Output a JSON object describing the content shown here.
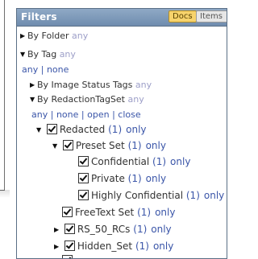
{
  "panel": {
    "title": "Filters",
    "buttons": {
      "docs": "Docs",
      "items": "Items"
    }
  },
  "folder": {
    "label": "By Folder",
    "value": "any"
  },
  "tag": {
    "label": "By Tag",
    "value": "any",
    "choices": {
      "any": "any",
      "sep": "|",
      "none": "none"
    }
  },
  "image_status": {
    "label": "By Image Status Tags",
    "value": "any"
  },
  "redaction": {
    "label": "By RedactionTagSet",
    "value": "any",
    "choices": {
      "any": "any",
      "sep1": "|",
      "none": "none",
      "sep2": "|",
      "open": "open",
      "sep3": "|",
      "close": "close"
    }
  },
  "tree": {
    "redacted": {
      "label": "Redacted",
      "count": "(1)",
      "only": "only"
    },
    "preset": {
      "label": "Preset Set",
      "count": "(1)",
      "only": "only"
    },
    "confidential": {
      "label": "Confidential",
      "count": "(1)",
      "only": "only"
    },
    "private": {
      "label": "Private",
      "count": "(1)",
      "only": "only"
    },
    "highly_confidential": {
      "label": "Highly Confidential",
      "count": "(1)",
      "only": "only"
    },
    "freetext": {
      "label": "FreeText Set",
      "count": "(1)",
      "only": "only"
    },
    "rs50": {
      "label": "RS_50_RCs",
      "count": "(1)",
      "only": "only"
    },
    "hidden": {
      "label": "Hidden_Set",
      "count": "(1)",
      "only": "only"
    }
  }
}
